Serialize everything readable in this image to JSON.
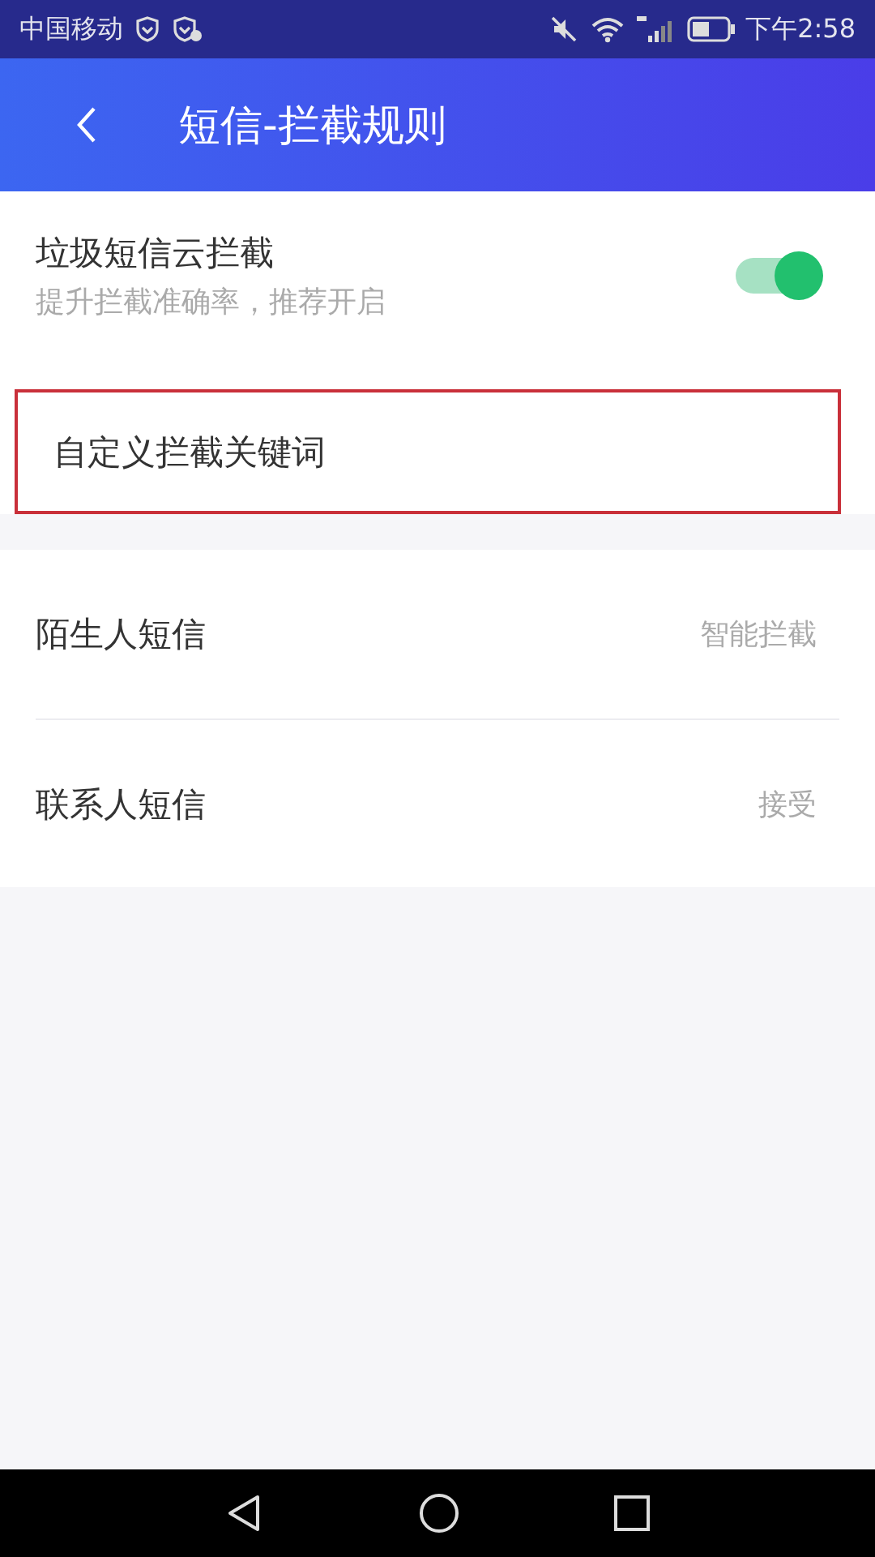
{
  "status_bar": {
    "carrier": "中国移动",
    "time": "下午2:58"
  },
  "header": {
    "title": "短信-拦截规则"
  },
  "sections": [
    {
      "items": [
        {
          "kind": "toggle",
          "title": "垃圾短信云拦截",
          "subtitle": "提升拦截准确率，推荐开启",
          "on": true,
          "highlighted": false
        },
        {
          "kind": "link",
          "title": "自定义拦截关键词",
          "highlighted": true
        }
      ]
    },
    {
      "items": [
        {
          "kind": "value",
          "title": "陌生人短信",
          "value": "智能拦截",
          "highlighted": false
        },
        {
          "kind": "value",
          "title": "联系人短信",
          "value": "接受",
          "highlighted": false
        }
      ]
    }
  ]
}
